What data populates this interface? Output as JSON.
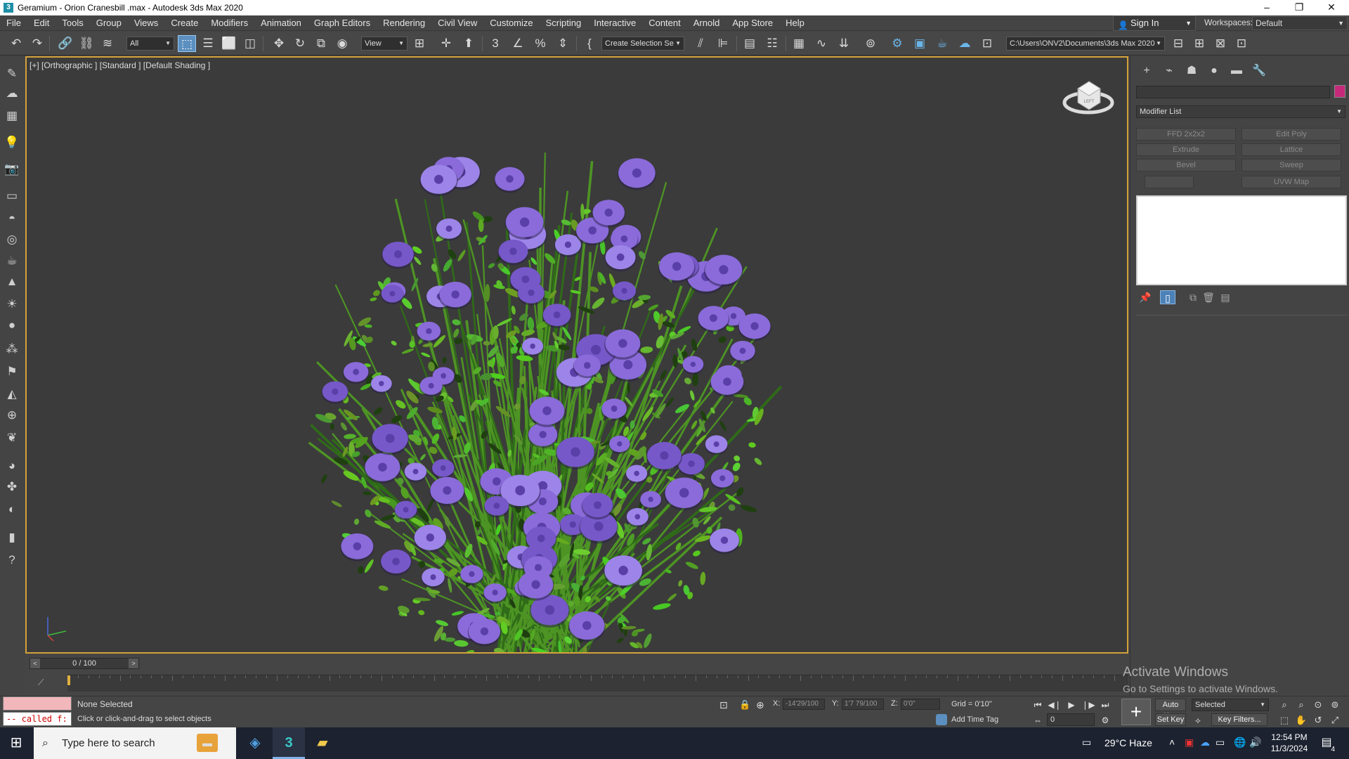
{
  "titlebar": {
    "title": "Geramium - Orion Cranesbill .max - Autodesk 3ds Max 2020",
    "app_icon": "3",
    "minimize": "–",
    "maximize": "❐",
    "close": "✕"
  },
  "menu": [
    "File",
    "Edit",
    "Tools",
    "Group",
    "Views",
    "Create",
    "Modifiers",
    "Animation",
    "Graph Editors",
    "Rendering",
    "Civil View",
    "Customize",
    "Scripting",
    "Interactive",
    "Content",
    "Arnold",
    "App Store",
    "Help"
  ],
  "account": {
    "signin": "Sign In",
    "workspaces_label": "Workspaces:",
    "workspace": "Default"
  },
  "toolbar": {
    "filter": "All",
    "ref_coord": "View",
    "selection_set": "Create Selection Se",
    "project_path": "C:\\Users\\ONV2\\Documents\\3ds Max 2020"
  },
  "viewport": {
    "label": "[+] [Orthographic ] [Standard ] [Default Shading ]",
    "cube_label": "LEFT",
    "flower_color": "#8a6bd9",
    "leaf_color": "#5fb02c",
    "border_color": "#d4a23a"
  },
  "timeline": {
    "frame": "0 / 100",
    "prev": "<",
    "next": ">"
  },
  "command_panel": {
    "modifier_list": "Modifier List",
    "buttons": [
      "FFD 2x2x2",
      "Edit Poly",
      "Extrude",
      "Lattice",
      "Bevel",
      "Sweep",
      "",
      "UVW Map"
    ],
    "object_color": "#c7297a"
  },
  "status": {
    "selection": "None Selected",
    "prompt": "Click or click-and-drag to select objects",
    "maxscript": "-- called f:",
    "x_label": "X:",
    "x_value": "-14'29/100",
    "y_label": "Y:",
    "y_value": "1'7 79/100",
    "z_label": "Z:",
    "z_value": "0'0\"",
    "grid": "Grid = 0'10\"",
    "add_time_tag": "Add Time Tag",
    "auto_key": "Auto Key",
    "set_key": "Set Key",
    "key_mode": "Selected",
    "key_filters": "Key Filters...",
    "current_frame": "0"
  },
  "watermark": {
    "line1": "Activate Windows",
    "line2": "Go to Settings to activate Windows."
  },
  "taskbar": {
    "search_placeholder": "Type here to search",
    "weather": "29°C  Haze",
    "time": "12:54 PM",
    "date": "11/3/2024",
    "notifications": "4"
  }
}
